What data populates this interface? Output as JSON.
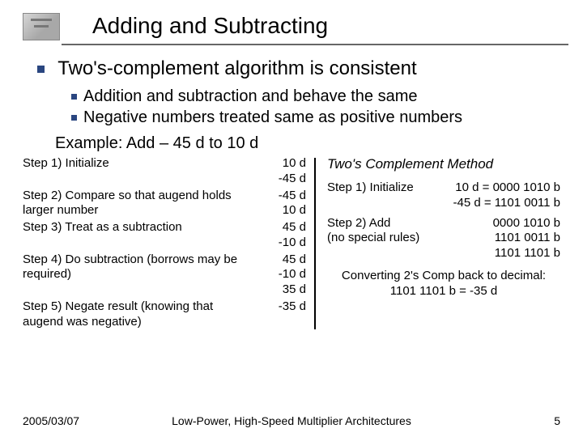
{
  "title": "Adding and Subtracting",
  "bullet_main": "Two's-complement algorithm is consistent",
  "sub_bullets": [
    "Addition and subtraction and behave the same",
    "Negative numbers treated same as positive numbers"
  ],
  "example_line": "Example: Add – 45 d to 10 d",
  "left_steps": [
    {
      "label": "Step 1) Initialize",
      "vals": " 10 d\n-45 d"
    },
    {
      "label": "Step 2) Compare so that augend holds larger number",
      "vals": "-45 d\n 10 d"
    },
    {
      "label": "Step 3) Treat as a subtraction",
      "vals": " 45 d\n-10 d"
    },
    {
      "label": "Step 4) Do subtraction (borrows may be required)",
      "vals": " 45 d\n-10 d\n 35 d"
    },
    {
      "label": "Step 5) Negate result (knowing that augend was negative)",
      "vals": "-35 d"
    }
  ],
  "right_heading": "Two's Complement Method",
  "right_steps": [
    {
      "label": "Step 1) Initialize",
      "vals": " 10 d = 0000 1010 b\n-45 d = 1101 0011 b"
    },
    {
      "label": "Step 2) Add\n(no special rules)",
      "vals": "0000 1010 b\n1101 0011 b\n1101 1101 b"
    }
  ],
  "convert_line1": "Converting 2's Comp back to decimal:",
  "convert_line2": "1101 1101 b = -35 d",
  "footer": {
    "date": "2005/03/07",
    "title": "Low-Power, High-Speed Multiplier Architectures",
    "page": "5"
  }
}
